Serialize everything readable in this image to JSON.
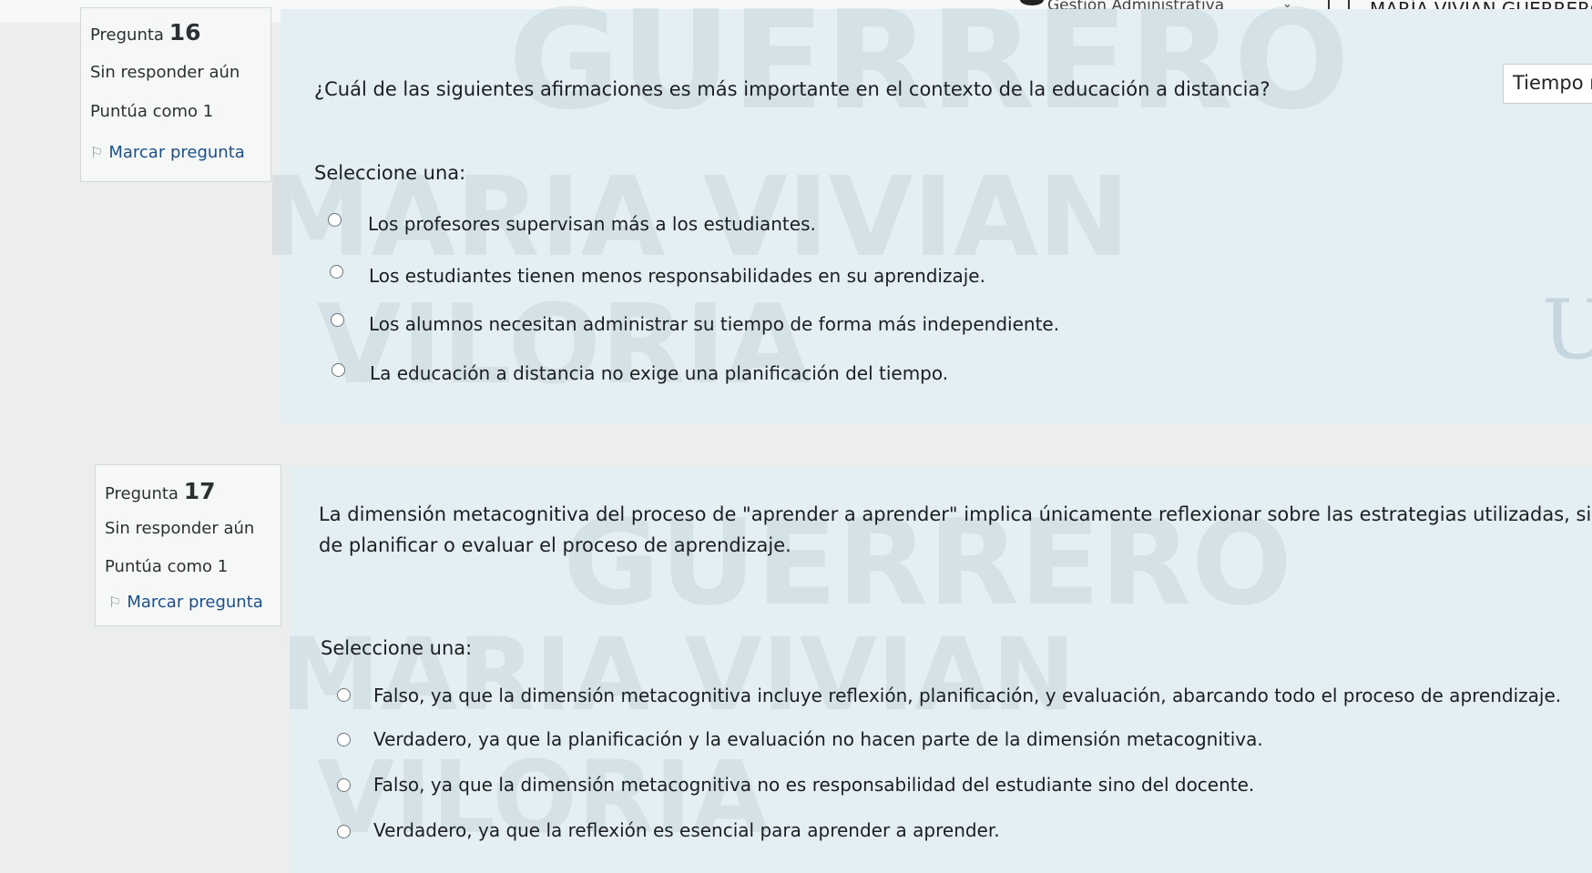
{
  "header": {
    "course_menu": "Gestión Administrativa",
    "user_name": "MARÍA VIVIAN GUERRERO"
  },
  "timer": {
    "label": "Tiempo r"
  },
  "watermark": {
    "line1": "GUERRERO",
    "line2": "MARIA VIVIAN",
    "line3": "VILORIA"
  },
  "q16": {
    "label": "Pregunta",
    "number": "16",
    "status": "Sin responder aún",
    "points": "Puntúa como 1",
    "flag": "Marcar pregunta",
    "text": "¿Cuál de las siguientes afirmaciones es más importante en el contexto de la educación a distancia?",
    "prompt": "Seleccione una:",
    "options": [
      "Los profesores supervisan más a los estudiantes.",
      "Los estudiantes tienen menos responsabilidades en su aprendizaje.",
      "Los alumnos necesitan administrar su tiempo de forma más independiente.",
      "La educación a distancia no exige una planificación del tiempo."
    ]
  },
  "q17": {
    "label": "Pregunta",
    "number": "17",
    "status": "Sin responder aún",
    "points": "Puntúa como 1",
    "flag": "Marcar pregunta",
    "text_line1": "La dimensión metacognitiva del proceso de \"aprender a aprender\" implica únicamente reflexionar sobre las estrategias utilizadas, sin la ne",
    "text_line2": "de planificar o evaluar el proceso de aprendizaje.",
    "prompt": "Seleccione una:",
    "options": [
      "Falso, ya que la dimensión metacognitiva incluye reflexión, planificación, y evaluación, abarcando todo el proceso de aprendizaje.",
      "Verdadero, ya que la planificación y la evaluación no hacen parte de la dimensión metacognitiva.",
      "Falso, ya que la dimensión metacognitiva no es responsabilidad del estudiante sino del docente.",
      "Verdadero, ya que la reflexión es esencial para aprender a aprender."
    ]
  }
}
